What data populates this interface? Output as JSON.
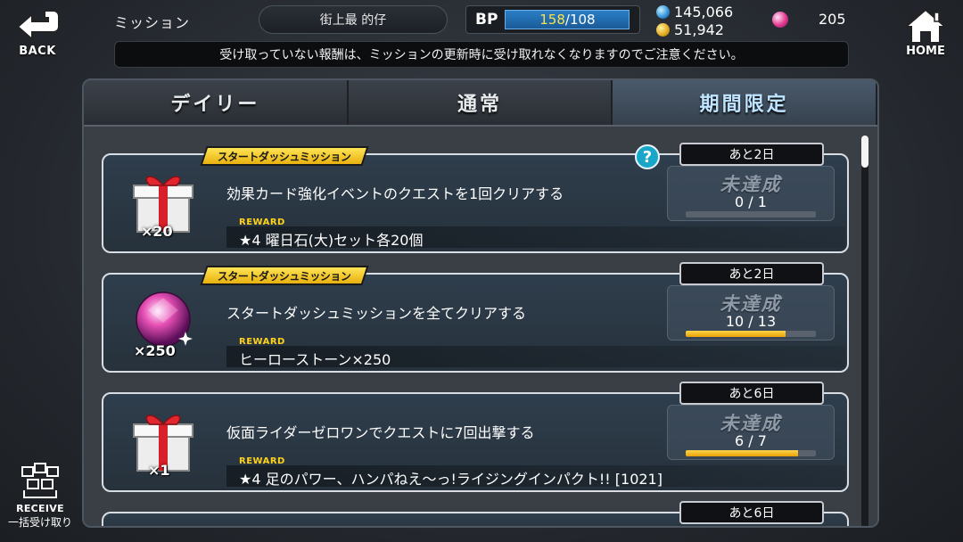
{
  "header": {
    "back_label": "BACK",
    "home_label": "HOME",
    "title": "ミッション",
    "player_name": "街上最 的仔",
    "bp_label": "BP",
    "bp_current": "158",
    "bp_max": "/108",
    "currency_blue": "145,066",
    "currency_gold": "51,942",
    "hero_stones": "205"
  },
  "notice": "受け取っていない報酬は、ミッションの更新時に受け取れなくなりますのでご注意ください。",
  "tabs": [
    {
      "label": "デイリー",
      "active": false
    },
    {
      "label": "通常",
      "active": false
    },
    {
      "label": "期間限定",
      "active": true
    }
  ],
  "missions": [
    {
      "tag": "スタートダッシュミッション",
      "deadline": "あと2日",
      "description": "効果カード強化イベントのクエストを1回クリアする",
      "reward_label": "REWARD",
      "reward": "★4 曜日石(大)セット各20個",
      "quantity": "×20",
      "status": "未達成",
      "progress_text": "0 / 1",
      "progress": 0.0,
      "icon": "gift-box-icon"
    },
    {
      "tag": "スタートダッシュミッション",
      "deadline": "あと2日",
      "description": "スタートダッシュミッションを全てクリアする",
      "reward_label": "REWARD",
      "reward": "ヒーローストーン×250",
      "quantity": "×250",
      "status": "未達成",
      "progress_text": "10 / 13",
      "progress": 0.77,
      "icon": "hero-stone-icon"
    },
    {
      "deadline": "あと6日",
      "description": "仮面ライダーゼロワンでクエストに7回出撃する",
      "reward_label": "REWARD",
      "reward": "★4 足のパワー、ハンパねえ～っ!ライジングインパクト!! [1021]",
      "quantity": "×1",
      "status": "未達成",
      "progress_text": "6 / 7",
      "progress": 0.86,
      "icon": "gift-box-icon"
    },
    {
      "deadline": "あと6日"
    }
  ],
  "receive_all": {
    "label": "RECEIVE",
    "sub_label": "一括受け取り"
  },
  "colors": {
    "accent_gold": "#ffd21a",
    "progress_fill": "#f0b21a",
    "active_tab_text": "#bfe4ff",
    "help_icon": "#1aa6c9"
  }
}
